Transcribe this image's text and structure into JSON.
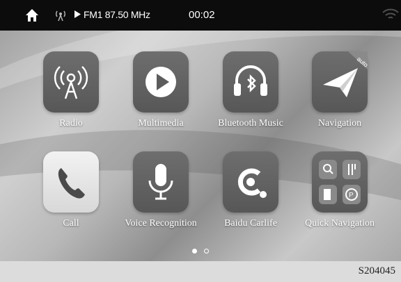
{
  "status_bar": {
    "frequency": "FM1 87.50 MHz",
    "time": "00:02",
    "icons": [
      "home-icon",
      "radio-signal-icon",
      "play-icon",
      "wifi-icon"
    ]
  },
  "apps": [
    {
      "label": "Radio",
      "icon": "radio-tower-icon"
    },
    {
      "label": "Multimedia",
      "icon": "play-circle-icon"
    },
    {
      "label": "Bluetooth Music",
      "icon": "bluetooth-headphones-icon"
    },
    {
      "label": "Navigation",
      "icon": "paper-plane-icon",
      "badge": "auto"
    },
    {
      "label": "Call",
      "icon": "phone-icon"
    },
    {
      "label": "Voice Recognition",
      "icon": "microphone-icon"
    },
    {
      "label": "Baidu Carlife",
      "icon": "carlife-icon"
    },
    {
      "label": "Quick Navigation",
      "icon": "quick-nav-grid-icon"
    }
  ],
  "pager": {
    "pages": 2,
    "active": 1
  },
  "caption": "S204045"
}
